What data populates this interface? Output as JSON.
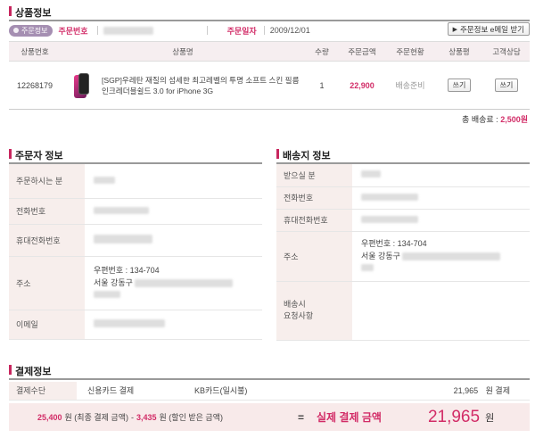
{
  "product_section": {
    "title": "상품정보",
    "order_badge": "주문정보",
    "order_number_label": "주문번호",
    "order_date_label": "주문일자",
    "order_date": "2009/12/01",
    "email_button": "주문정보 e메일 받기",
    "columns": [
      "상품번호",
      "상품명",
      "수량",
      "주문금액",
      "주문현황",
      "상품평",
      "고객상담"
    ],
    "items": [
      {
        "product_no": "12268179",
        "name": "[SGP]우레탄 재질의 섬세한 최고레벨의 투명 소프트 스킨 필름 인크레더블쉴드 3.0 for iPhone 3G",
        "qty": "1",
        "price": "22,900",
        "status": "배송준비",
        "review_button": "쓰기",
        "consult_button": "쓰기"
      }
    ],
    "shipping_label": "총 배송료 :",
    "shipping_value": "2,500원"
  },
  "orderer_section": {
    "title": "주문자 정보",
    "rows": [
      {
        "label": "주문하시는 분"
      },
      {
        "label": "전화번호"
      },
      {
        "label": "휴대전화번호"
      },
      {
        "label": "주소",
        "zip": "우편번호 : 134-704",
        "addr": "서울 강동구"
      },
      {
        "label": "이메일"
      }
    ]
  },
  "delivery_section": {
    "title": "배송지 정보",
    "rows": [
      {
        "label": "받으실 분"
      },
      {
        "label": "전화번호"
      },
      {
        "label": "휴대전화번호"
      },
      {
        "label": "주소",
        "zip": "우편번호 : 134-704",
        "addr": "서울 강동구"
      },
      {
        "label": "배송시\n요청사항"
      }
    ]
  },
  "payment_section": {
    "title": "결제정보",
    "method_label": "결제수단",
    "method_value": "신용카드 결제",
    "card_value": "KB카드(일시불)",
    "paid_amount": "21,965",
    "paid_suffix": "원 결제",
    "final_amount": "25,400",
    "final_amount_label": "원 (최종 결제 금액)",
    "minus": "-",
    "discount_amount": "3,435",
    "discount_label": "원 (할인 받은 금액)",
    "equals": "=",
    "actual_label": "실제 결제 금액",
    "actual_amount": "21,965",
    "won": "원"
  },
  "colors": {
    "accent": "#d22c67",
    "label_bg": "#f7eeec",
    "badge_bg": "#a58fb2"
  }
}
